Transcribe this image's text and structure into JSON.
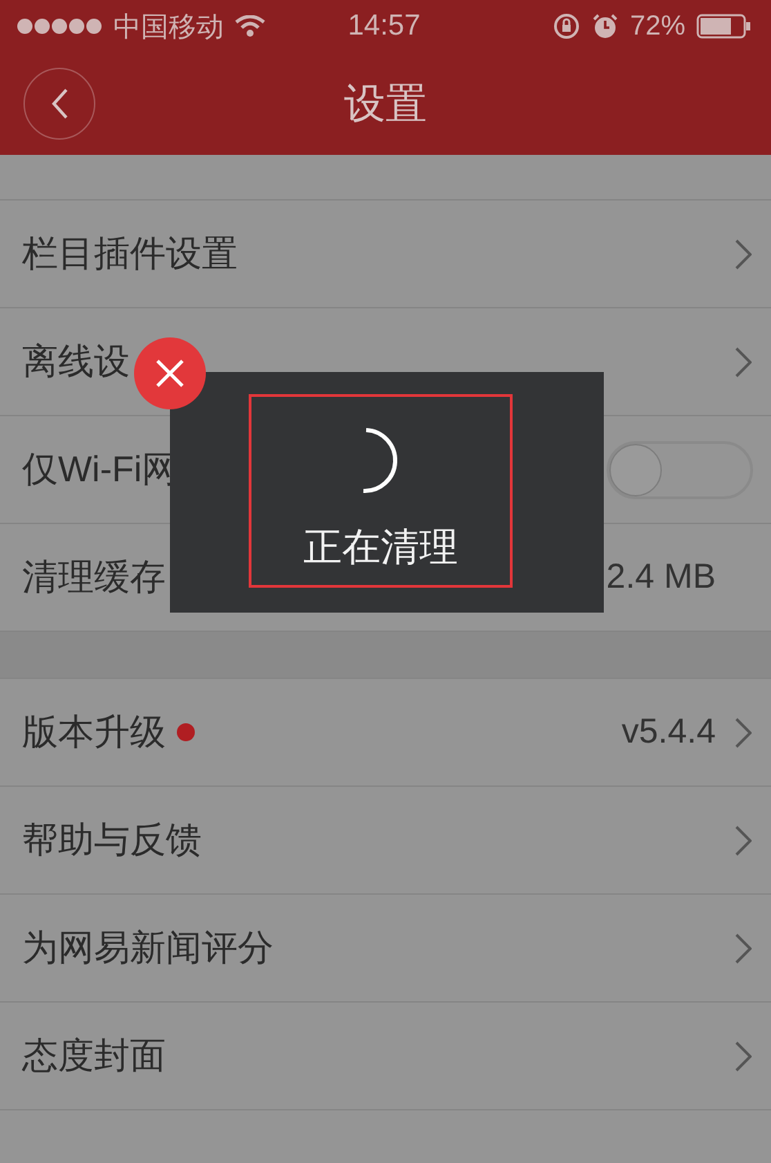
{
  "status_bar": {
    "carrier": "中国移动",
    "time": "14:57",
    "battery": "72%"
  },
  "nav": {
    "title": "设置"
  },
  "sections": [
    {
      "rows": [
        {
          "kind": "link",
          "label": "栏目插件设置"
        },
        {
          "kind": "link",
          "label": "离线设"
        },
        {
          "kind": "toggle",
          "label": "仅Wi-Fi网",
          "on": false
        },
        {
          "kind": "value",
          "label": "清理缓存",
          "value": "2.4 MB"
        }
      ]
    },
    {
      "rows": [
        {
          "kind": "link",
          "label": "版本升级",
          "dot": true,
          "value": "v5.4.4"
        },
        {
          "kind": "link",
          "label": "帮助与反馈"
        },
        {
          "kind": "link",
          "label": "为网易新闻评分"
        },
        {
          "kind": "link",
          "label": "态度封面"
        }
      ]
    }
  ],
  "toast": {
    "text": "正在清理"
  }
}
